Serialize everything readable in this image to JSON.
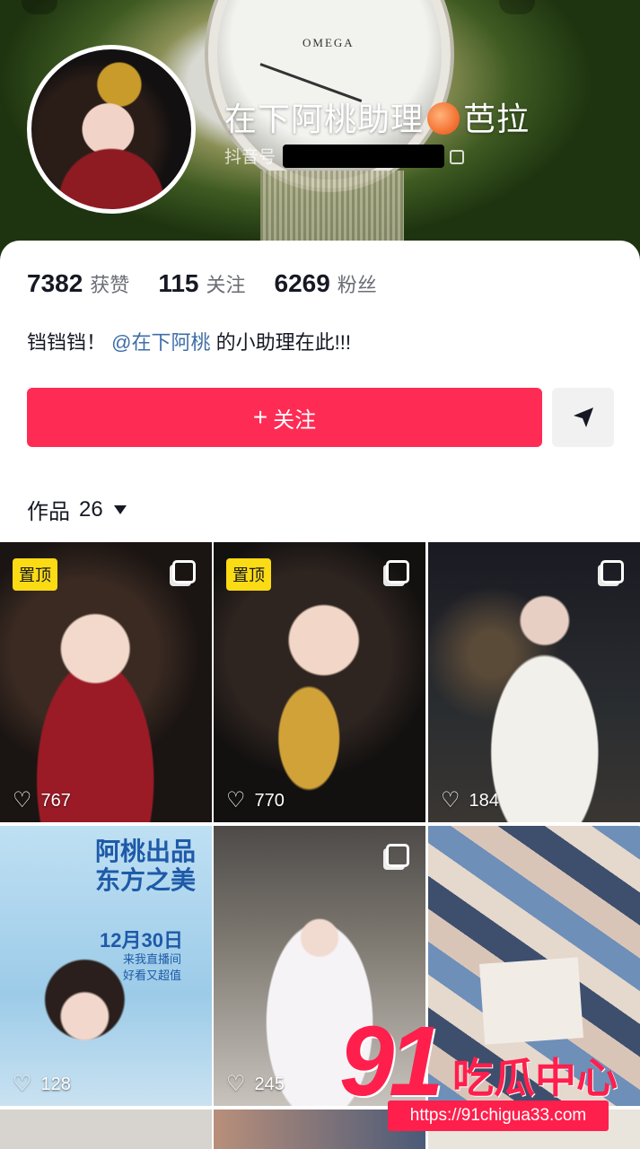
{
  "profile": {
    "name_prefix": "在下阿桃助理",
    "name_suffix": "芭拉",
    "id_label": "抖音号"
  },
  "stats": [
    {
      "value": "7382",
      "label": "获赞"
    },
    {
      "value": "115",
      "label": "关注"
    },
    {
      "value": "6269",
      "label": "粉丝"
    }
  ],
  "bio": {
    "prefix": "铛铛铛！",
    "mention": "@在下阿桃",
    "suffix": "的小助理在此!!!"
  },
  "actions": {
    "follow_label": "关注",
    "follow_plus": "+"
  },
  "works": {
    "label": "作品",
    "count": "26"
  },
  "tiles": [
    {
      "badge": "置顶",
      "likes": "767"
    },
    {
      "badge": "置顶",
      "likes": "770"
    },
    {
      "badge": "",
      "likes": "184"
    },
    {
      "badge": "",
      "likes": "128",
      "poster_title_1": "阿桃出品",
      "poster_title_2": "东方之美",
      "poster_date": "12月30日",
      "poster_sub_1": "来我直播间",
      "poster_sub_2": "好看又超值"
    },
    {
      "badge": "",
      "likes": "245"
    },
    {
      "badge": "",
      "likes": ""
    }
  ],
  "watermark": {
    "number": "91",
    "text": "吃瓜中心",
    "url": "https://91chigua33.com"
  },
  "watch_brand": "OMEGA",
  "colors": {
    "accent": "#fe2c55",
    "mention": "#3e6ea7",
    "badge": "#fadb14"
  }
}
